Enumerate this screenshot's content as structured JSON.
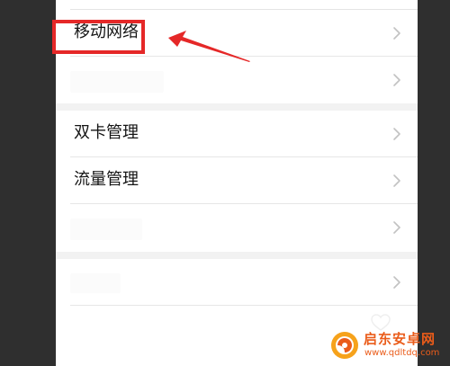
{
  "settings_list": {
    "group1": {
      "items": [
        {
          "label": "移动网络"
        },
        {
          "label": ""
        }
      ]
    },
    "group2": {
      "items": [
        {
          "label": "双卡管理"
        },
        {
          "label": "流量管理"
        },
        {
          "label": ""
        }
      ]
    },
    "group3": {
      "items": [
        {
          "label": ""
        }
      ]
    }
  },
  "annotation": {
    "highlight_color": "#e52828",
    "highlighted_item": "移动网络"
  },
  "watermark": {
    "name": "启东安卓网",
    "url": "www.qdltdq.com",
    "color": "#ea5c1a"
  },
  "icons": {
    "chevron": "chevron-right-icon",
    "heart": "heart-icon",
    "logo": "watermark-logo-icon"
  }
}
